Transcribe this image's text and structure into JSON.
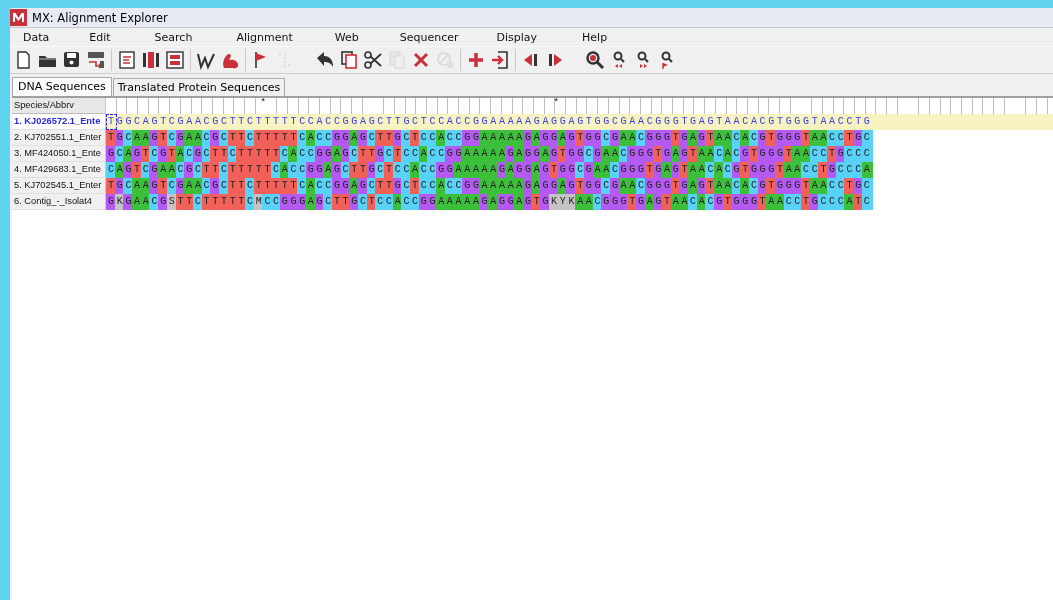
{
  "window": {
    "title": "MX: Alignment Explorer"
  },
  "menu": [
    "Data",
    "Edit",
    "Search",
    "Alignment",
    "Web",
    "Sequencer",
    "Display",
    "Help"
  ],
  "toolbar": [
    {
      "kind": "new",
      "disabled": false
    },
    {
      "kind": "open",
      "disabled": false
    },
    {
      "kind": "save",
      "disabled": false
    },
    {
      "kind": "translate",
      "disabled": false
    },
    {
      "kind": "separator"
    },
    {
      "kind": "edit",
      "disabled": false
    },
    {
      "kind": "align",
      "disabled": false
    },
    {
      "kind": "atcg",
      "disabled": false
    },
    {
      "kind": "separator"
    },
    {
      "kind": "web",
      "disabled": false
    },
    {
      "kind": "muscle",
      "disabled": false
    },
    {
      "kind": "separator"
    },
    {
      "kind": "flag",
      "disabled": false
    },
    {
      "kind": "indent",
      "disabled": true
    },
    {
      "kind": "gap"
    },
    {
      "kind": "undo",
      "disabled": false
    },
    {
      "kind": "copy",
      "disabled": false
    },
    {
      "kind": "cut",
      "disabled": false
    },
    {
      "kind": "paste",
      "disabled": true
    },
    {
      "kind": "delete",
      "disabled": false
    },
    {
      "kind": "block",
      "disabled": true
    },
    {
      "kind": "separator"
    },
    {
      "kind": "add",
      "disabled": false
    },
    {
      "kind": "import",
      "disabled": false
    },
    {
      "kind": "separator"
    },
    {
      "kind": "prev",
      "disabled": false
    },
    {
      "kind": "next",
      "disabled": false
    },
    {
      "kind": "gap"
    },
    {
      "kind": "find",
      "disabled": false
    },
    {
      "kind": "findprev",
      "disabled": false
    },
    {
      "kind": "findnext",
      "disabled": false
    },
    {
      "kind": "findmark",
      "disabled": false
    }
  ],
  "tabs": [
    {
      "label": "DNA Sequences",
      "selected": true
    },
    {
      "label": "Translated Protein Sequences",
      "selected": false
    }
  ],
  "grid": {
    "header": "Species/Abbrv",
    "marks": "               *                            *",
    "rows": [
      {
        "name": "1. KJ026572.1_Ente",
        "sequence": "TGGCAGTCGAACGCTTCTTTTTCCACCGGAGCTTGCTCCACCGGAAAAAGAGGAGTGGCGAACGGGTGAGTAACACGTGGGTAACCTG",
        "selected": true
      },
      {
        "name": "2. KJ702551.1_Enter",
        "sequence": "TGCAAGTCGAACGCTTCTTTTTCACCGGAGCTTGCTCCACCGGAAAAAGAGGAGTGGCGAACGGGTGAGTAACACGTGGGTAACCTGC",
        "selected": false
      },
      {
        "name": "3. MF424050.1_Ente",
        "sequence": "GCAGTCGTACGCTTCTTTTTCACCGGAGCTTGCTCCACCGGAAAAAGAGGAGTGGCGAACGGGTGAGTAACACGTGGGTAACCTGCCC",
        "selected": false
      },
      {
        "name": "4. MF429683.1_Ente",
        "sequence": "CAGTCGAACGCTTCTTTTTCACCGGAGCTTGCTCCACCGGAAAAAGAGGAGTGGCGAACGGGTGAGTAACACGTGGGTAACCTGCCCA",
        "selected": false
      },
      {
        "name": "5. KJ702545.1_Enter",
        "sequence": "TGCAAGTCGAACGCTTCTTTTTCACCGGAGCTTGCTCCACCGGAAAAAGAGGAGTGGCGAACGGGTGAGTAACACGTGGGTAACCTGC",
        "selected": false
      },
      {
        "name": "6. Contig_-_Isolat4",
        "sequence": "GKGAACGSTTCTTTTTCMCCGGGAGCTTGCTCCACCGGAAAAAGAGGAGTGKYKAACGGGTGAGTAACACGTGGGTAACCTGCCCATC",
        "selected": false
      }
    ]
  }
}
